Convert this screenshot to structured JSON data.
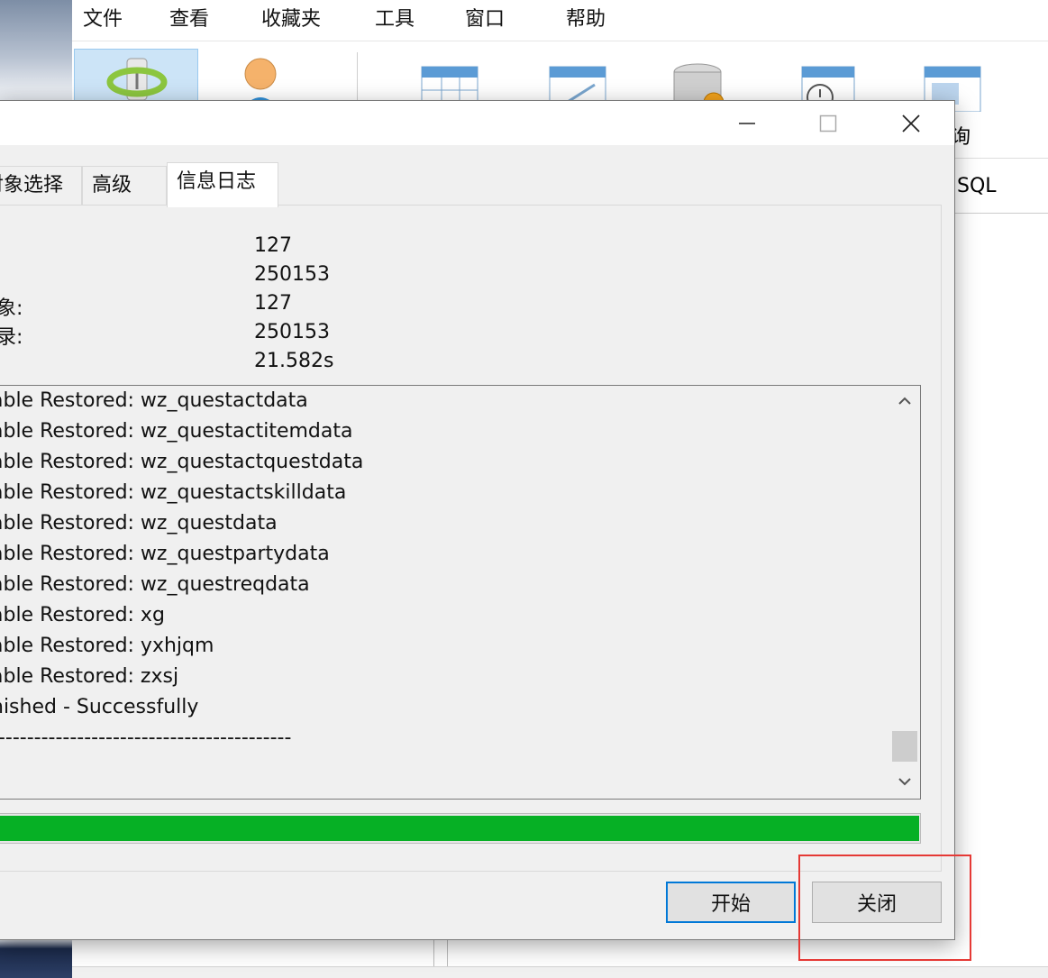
{
  "menubar": {
    "items": [
      "文件",
      "查看",
      "收藏夹",
      "工具",
      "窗口",
      "帮助"
    ]
  },
  "toolbar": {
    "icons": [
      "connection-icon",
      "user-icon",
      "table-icon",
      "view-icon",
      "function-icon",
      "event-icon",
      "query-icon"
    ],
    "partial_label": "询"
  },
  "sql_tab_label": "SQL",
  "dialog": {
    "window_controls": {
      "minimize": "—",
      "maximize": "☐",
      "close": "✕"
    },
    "tabs": [
      {
        "label": "对象选择"
      },
      {
        "label": "高级"
      },
      {
        "label": "信息日志"
      }
    ],
    "stats": [
      {
        "label": "",
        "value": "127"
      },
      {
        "label": "",
        "value": "250153"
      },
      {
        "label": "象:",
        "value": "127"
      },
      {
        "label": "录:",
        "value": "250153"
      },
      {
        "label": "",
        "value": "21.582s"
      }
    ],
    "log_lines": [
      "able Restored: wz_questactdata",
      "able Restored: wz_questactitemdata",
      "able Restored: wz_questactquestdata",
      "able Restored: wz_questactskilldata",
      "able Restored: wz_questdata",
      "able Restored: wz_questpartydata",
      "able Restored: wz_questreqdata",
      "able Restored: xg",
      "able Restored: yxhjqm",
      "able Restored: zxsj",
      "nished - Successfully",
      "------------------------------------------"
    ],
    "progress_fraction": 1.0,
    "progress_color": "#06b025",
    "buttons": {
      "start": "开始",
      "close": "关闭"
    },
    "scroll_up": "⌃",
    "scroll_down": "⌄"
  },
  "highlight_color": "#e53935"
}
